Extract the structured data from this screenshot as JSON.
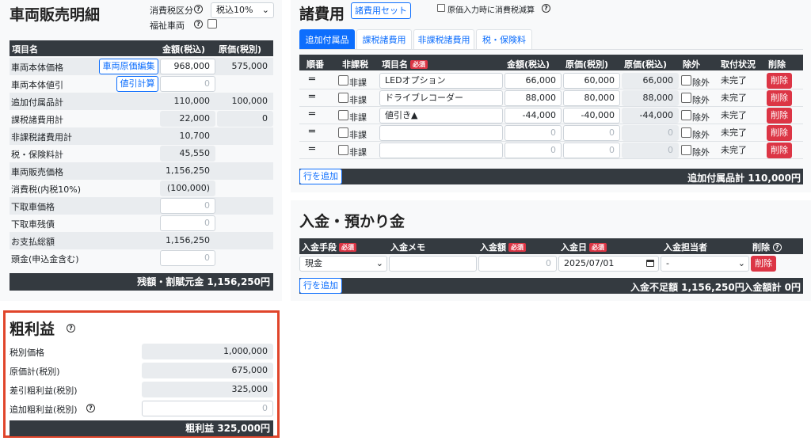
{
  "sales": {
    "title": "車両販売明細",
    "tax_label": "消費税区分",
    "tax_select": "税込10%",
    "welfare_label": "福祉車両",
    "head": {
      "item": "項目名",
      "amount": "金額(税込)",
      "cost": "原価(税別)"
    },
    "rows": [
      {
        "label": "車両本体価格",
        "btn": "車両原価編集",
        "amount": "968,000",
        "cost": "575,000"
      },
      {
        "label": "車両本体値引",
        "btn": "値引計算",
        "amount": "0"
      },
      {
        "label": "追加付属品計",
        "amount": "110,000",
        "cost": "100,000"
      },
      {
        "label": "課税諸費用計",
        "amount": "22,000",
        "cost": "0"
      },
      {
        "label": "非課税諸費用計",
        "amount": "10,700"
      },
      {
        "label": "税・保険料計",
        "amount": "45,550"
      },
      {
        "label": "車両販売価格",
        "amount": "1,156,250"
      },
      {
        "label": "消費税(内税10%)",
        "amount": "(100,000)"
      },
      {
        "label": "下取車価格",
        "amount": "0"
      },
      {
        "label": "下取車残債",
        "amount": "0"
      },
      {
        "label": "お支払総額",
        "amount": "1,156,250"
      },
      {
        "label": "頭金(申込金含む)",
        "amount": "0"
      }
    ],
    "footer": "残額・割賦元金 1,156,250円"
  },
  "profit": {
    "title": "粗利益",
    "rows": [
      {
        "label": "税別価格",
        "value": "1,000,000"
      },
      {
        "label": "原価計(税別)",
        "value": "675,000"
      },
      {
        "label": "差引粗利益(税別)",
        "value": "325,000"
      },
      {
        "label": "追加粗利益(税別)",
        "value": "0"
      }
    ],
    "footer": "粗利益 325,000円",
    "highlight_color": "#e0452b"
  },
  "expenses": {
    "title": "諸費用",
    "set_button": "諸費用セット",
    "cost_tax_label": "原価入力時に消費税減算",
    "tabs": [
      "追加付属品",
      "課税諸費用",
      "非課税諸費用",
      "税・保険料"
    ],
    "head": {
      "order": "順番",
      "nontax": "非課税",
      "name": "項目名",
      "required": "必須",
      "amount": "金額(税込)",
      "cost_ex": "原価(税別)",
      "cost_in": "原価(税込)",
      "exclude": "除外",
      "status": "取付状況",
      "delete": "削除"
    },
    "rows": [
      {
        "nontax": "非課",
        "name": "LEDオプション",
        "amount": "66,000",
        "cost_ex": "60,000",
        "cost_in": "66,000",
        "exclude": "除外",
        "status": "未完了",
        "delete": "削除"
      },
      {
        "nontax": "非課",
        "name": "ドライブレコーダー",
        "amount": "88,000",
        "cost_ex": "80,000",
        "cost_in": "88,000",
        "exclude": "除外",
        "status": "未完了",
        "delete": "削除"
      },
      {
        "nontax": "非課",
        "name": "値引き▲",
        "amount": "-44,000",
        "cost_ex": "-40,000",
        "cost_in": "-44,000",
        "exclude": "除外",
        "status": "未完了",
        "delete": "削除"
      },
      {
        "nontax": "非課",
        "name": "",
        "amount": "0",
        "cost_ex": "0",
        "cost_in": "0",
        "exclude": "除外",
        "status": "未完了",
        "delete": "削除"
      },
      {
        "nontax": "非課",
        "name": "",
        "amount": "0",
        "cost_ex": "0",
        "cost_in": "0",
        "exclude": "除外",
        "status": "未完了",
        "delete": "削除"
      }
    ],
    "add_row": "行を追加",
    "footer": "追加付属品計 110,000円"
  },
  "deposit": {
    "title": "入金・預かり金",
    "head": {
      "method": "入金手段",
      "memo": "入金メモ",
      "amount": "入金額",
      "date": "入金日",
      "staff": "入金担当者",
      "delete": "削除",
      "required": "必須"
    },
    "row": {
      "method": "現金",
      "memo": "",
      "amount": "0",
      "date": "2025/07/01",
      "staff": "-",
      "delete": "削除"
    },
    "add_row": "行を追加",
    "shortage": "入金不足額 1,156,250円",
    "total": "入金額計 0円"
  }
}
